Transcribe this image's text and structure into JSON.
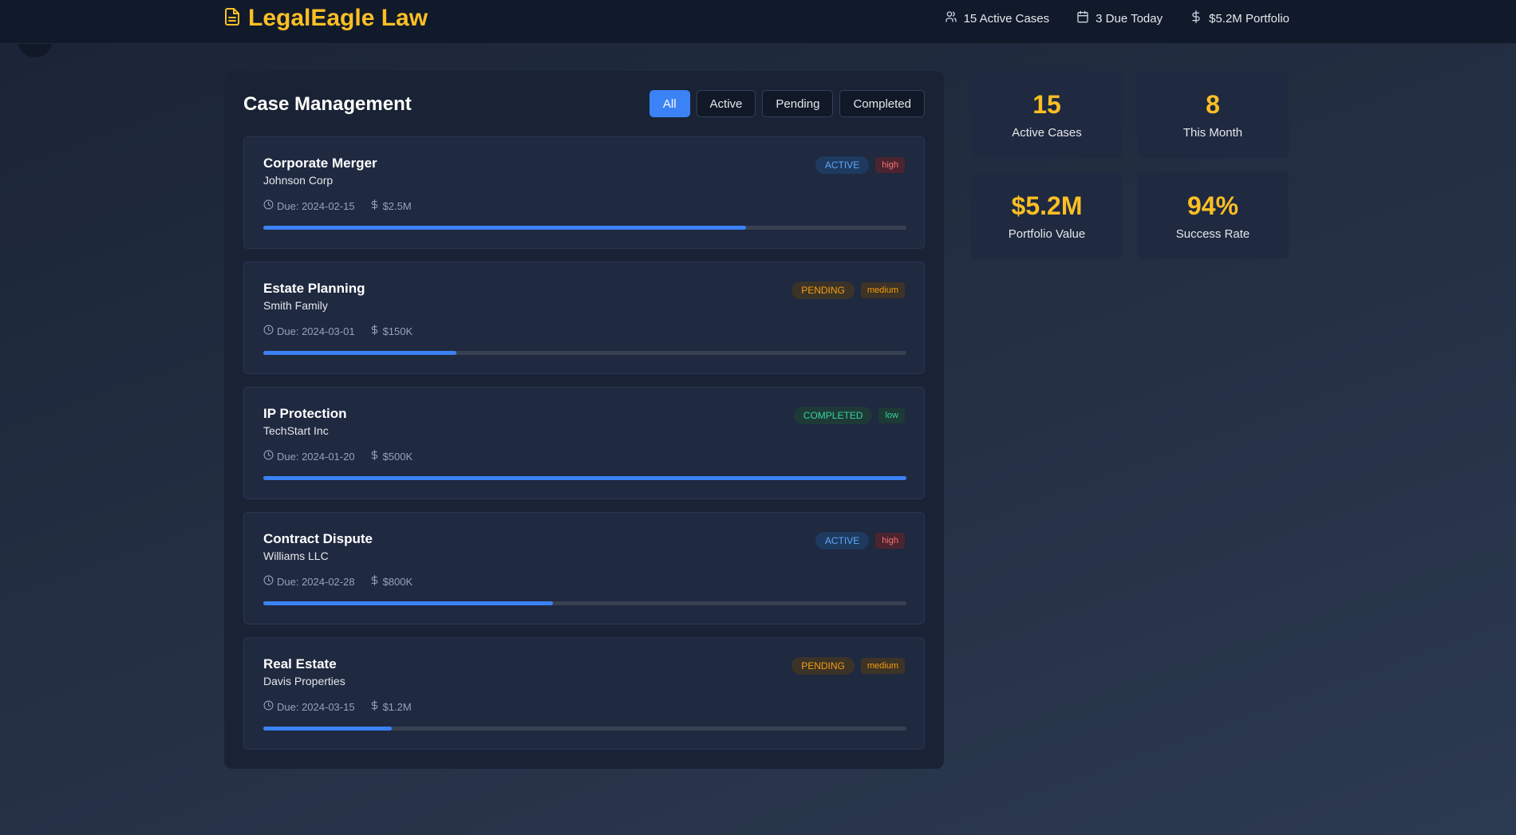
{
  "header": {
    "brand": "LegalEagle Law",
    "stats": [
      {
        "icon": "users-icon",
        "label": "15 Active Cases"
      },
      {
        "icon": "calendar-icon",
        "label": "3 Due Today"
      },
      {
        "icon": "dollar-icon",
        "label": "$5.2M Portfolio"
      }
    ]
  },
  "main": {
    "title": "Case Management",
    "filters": [
      "All",
      "Active",
      "Pending",
      "Completed"
    ],
    "selected_filter": "All",
    "cases": [
      {
        "title": "Corporate Merger",
        "client": "Johnson Corp",
        "due": "Due: 2024-02-15",
        "value": "$2.5M",
        "status": "ACTIVE",
        "priority": "high",
        "progress": 0.75
      },
      {
        "title": "Estate Planning",
        "client": "Smith Family",
        "due": "Due: 2024-03-01",
        "value": "$150K",
        "status": "PENDING",
        "priority": "medium",
        "progress": 0.3
      },
      {
        "title": "IP Protection",
        "client": "TechStart Inc",
        "due": "Due: 2024-01-20",
        "value": "$500K",
        "status": "COMPLETED",
        "priority": "low",
        "progress": 1.0
      },
      {
        "title": "Contract Dispute",
        "client": "Williams LLC",
        "due": "Due: 2024-02-28",
        "value": "$800K",
        "status": "ACTIVE",
        "priority": "high",
        "progress": 0.45
      },
      {
        "title": "Real Estate",
        "client": "Davis Properties",
        "due": "Due: 2024-03-15",
        "value": "$1.2M",
        "status": "PENDING",
        "priority": "medium",
        "progress": 0.2
      }
    ]
  },
  "stats": [
    {
      "value": "15",
      "label": "Active Cases"
    },
    {
      "value": "8",
      "label": "This Month"
    },
    {
      "value": "$5.2M",
      "label": "Portfolio Value"
    },
    {
      "value": "94%",
      "label": "Success Rate"
    }
  ],
  "colors": {
    "accent": "#fbbf24",
    "primary": "#3b82f6",
    "status": {
      "ACTIVE": {
        "bg": "#1e3a5f",
        "fg": "#60a5fa"
      },
      "PENDING": {
        "bg": "#3b3328",
        "fg": "#f59e0b"
      },
      "COMPLETED": {
        "bg": "#1e3a38",
        "fg": "#34d399"
      }
    },
    "priority": {
      "high": {
        "bg": "#4a2530",
        "fg": "#f87171"
      },
      "medium": {
        "bg": "#3d3326",
        "fg": "#f59e0b"
      },
      "low": {
        "bg": "#1d3a35",
        "fg": "#34d399"
      }
    }
  }
}
